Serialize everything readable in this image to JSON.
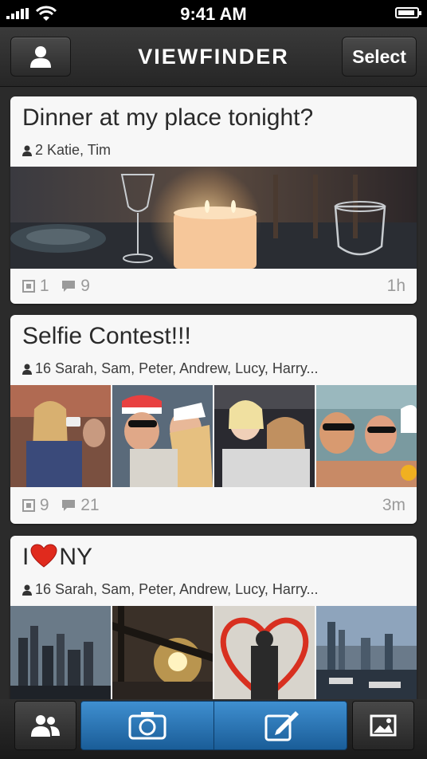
{
  "status_bar": {
    "time": "9:41 AM"
  },
  "nav": {
    "title": "VIEWFINDER",
    "select_label": "Select"
  },
  "conversations": [
    {
      "title": "Dinner at my place tonight?",
      "people_count": "2",
      "people": "Katie, Tim",
      "photo_count": "1",
      "comment_count": "9",
      "age": "1h"
    },
    {
      "title": "Selfie Contest!!!",
      "people_count": "16",
      "people": "Sarah, Sam, Peter, Andrew, Lucy, Harry...",
      "photo_count": "9",
      "comment_count": "21",
      "age": "3m"
    },
    {
      "title_prefix": "I",
      "title_suffix": "NY",
      "people_count": "16",
      "people": "Sarah, Sam, Peter, Andrew, Lucy, Harry..."
    }
  ],
  "colors": {
    "accent_blue": "#2a78bd",
    "heart_red": "#e02a1d"
  }
}
